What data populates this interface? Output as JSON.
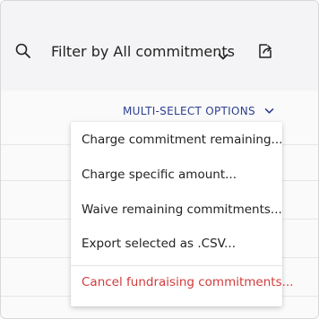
{
  "toolbar": {
    "search_icon": "search-icon",
    "filter_label": "Filter by All commitments",
    "filter_chevron_icon": "chevron-down-icon",
    "export_icon": "export-icon"
  },
  "multi_select": {
    "label": "MULTI-SELECT OPTIONS",
    "chevron_icon": "chevron-down-icon",
    "color": "#2d3f8f"
  },
  "menu": {
    "items": [
      {
        "label": "Charge commitment remaining..."
      },
      {
        "label": "Charge specific amount..."
      },
      {
        "label": "Waive remaining commitments..."
      },
      {
        "label": "Export selected as .CSV..."
      },
      {
        "label": "Cancel fundraising commitments...",
        "color": "#d23a3a"
      }
    ]
  }
}
